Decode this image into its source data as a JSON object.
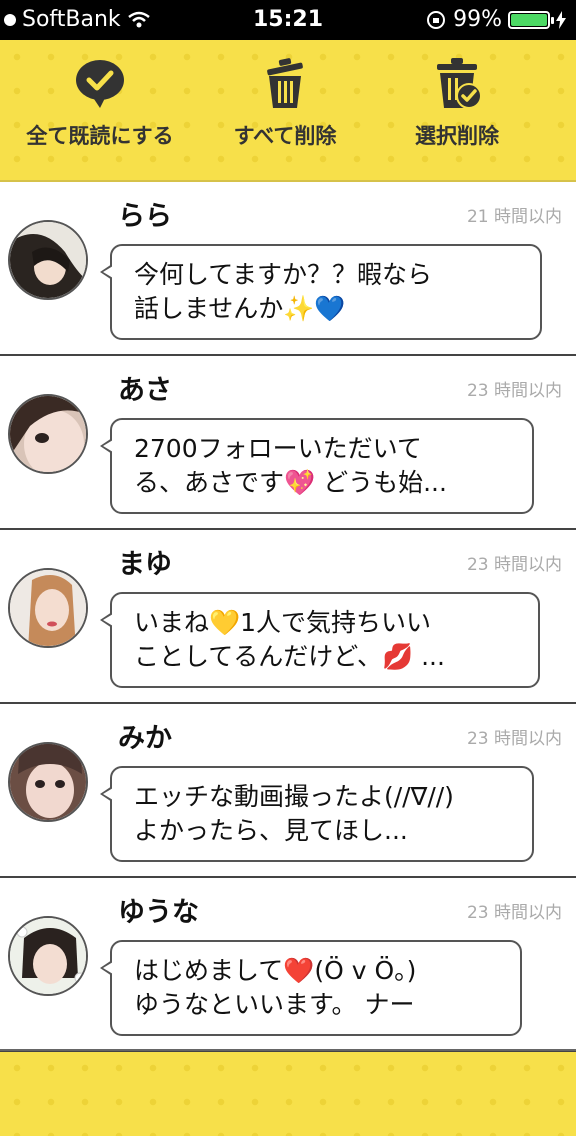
{
  "status_bar": {
    "carrier": "SoftBank",
    "time": "15:21",
    "battery": "99%",
    "battery_level": 0.99
  },
  "toolbar": {
    "mark_all_read": "全て既読にする",
    "delete_all": "すべて削除",
    "delete_selected": "選択削除"
  },
  "messages": [
    {
      "name": "らら",
      "time": "21 時間以内",
      "line1": "今何してますか？？暇なら",
      "line2": "話しませんか✨💙"
    },
    {
      "name": "あさ",
      "time": "23 時間以内",
      "line1": "2700フォローいただいて",
      "line2": "る、あさです💖 どうも始..."
    },
    {
      "name": "まゆ",
      "time": "23 時間以内",
      "line1": "いまね💛1人で気持ちいい",
      "line2": "ことしてるんだけど、💋 ..."
    },
    {
      "name": "みか",
      "time": "23 時間以内",
      "line1": "エッチな動画撮ったよ(//∇//)",
      "line2": "よかったら、見てほし..."
    },
    {
      "name": "ゆうな",
      "time": "23 時間以内",
      "line1": "はじめまして❤️(Ö v Ö。)",
      "line2": "ゆうなといいます。 ナー"
    }
  ]
}
